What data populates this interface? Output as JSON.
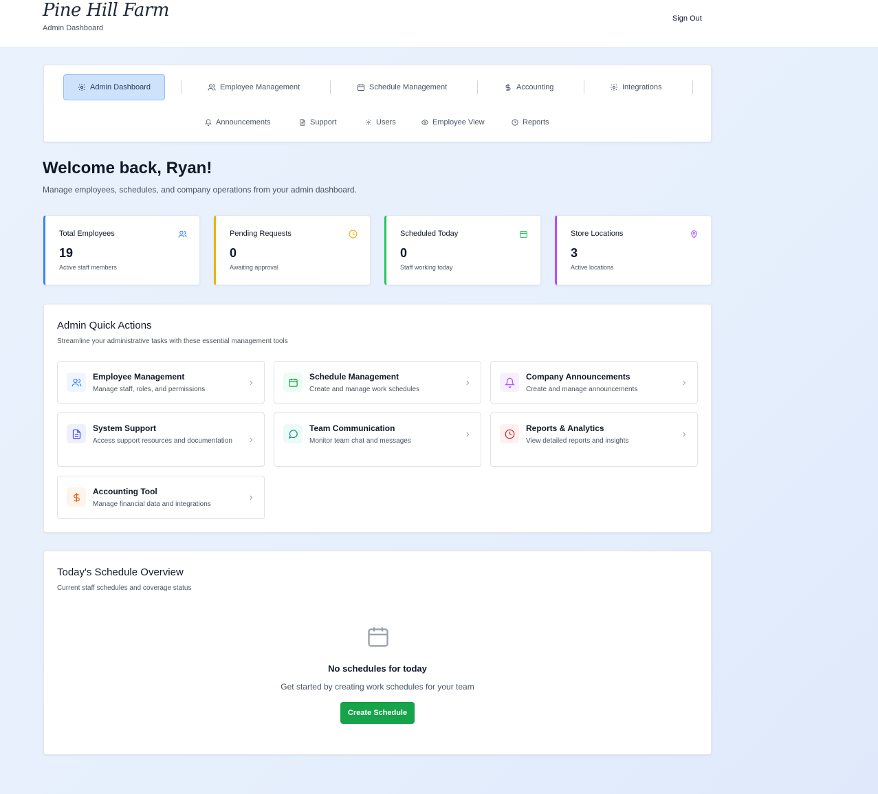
{
  "header": {
    "logo_text": "Pine Hill Farm",
    "subtitle": "Admin Dashboard",
    "sign_out": "Sign Out"
  },
  "nav": {
    "row1": [
      {
        "label": "Admin Dashboard",
        "icon": "gear-icon",
        "active": true
      },
      {
        "label": "Employee Management",
        "icon": "users-icon"
      },
      {
        "label": "Schedule Management",
        "icon": "calendar-icon"
      },
      {
        "label": "Accounting",
        "icon": "dollar-icon"
      },
      {
        "label": "Integrations",
        "icon": "gear-icon"
      }
    ],
    "row2": [
      {
        "label": "Announcements",
        "icon": "bell-icon"
      },
      {
        "label": "Support",
        "icon": "document-icon"
      },
      {
        "label": "Users",
        "icon": "gear-icon"
      },
      {
        "label": "Employee View",
        "icon": "eye-icon"
      },
      {
        "label": "Reports",
        "icon": "clock-icon"
      }
    ]
  },
  "welcome": {
    "title": "Welcome back, Ryan!",
    "subtitle": "Manage employees, schedules, and company operations from your admin dashboard."
  },
  "stats": [
    {
      "label": "Total Employees",
      "value": "19",
      "desc": "Active staff members",
      "icon": "users-icon",
      "color": "#3b82f6"
    },
    {
      "label": "Pending Requests",
      "value": "0",
      "desc": "Awaiting approval",
      "icon": "clock-icon",
      "color": "#eab308"
    },
    {
      "label": "Scheduled Today",
      "value": "0",
      "desc": "Staff working today",
      "icon": "calendar-icon",
      "color": "#22c55e"
    },
    {
      "label": "Store Locations",
      "value": "3",
      "desc": "Active locations",
      "icon": "map-pin-icon",
      "color": "#a855f7"
    }
  ],
  "quick_actions": {
    "title": "Admin Quick Actions",
    "subtitle": "Streamline your administrative tasks with these essential management tools",
    "items": [
      {
        "title": "Employee Management",
        "desc": "Manage staff, roles, and permissions",
        "icon": "users-icon",
        "color": "#3b82f6",
        "bg": "#eff6ff"
      },
      {
        "title": "Schedule Management",
        "desc": "Create and manage work schedules",
        "icon": "calendar-icon",
        "color": "#16a34a",
        "bg": "#ecfdf3"
      },
      {
        "title": "Company Announcements",
        "desc": "Create and manage announcements",
        "icon": "bell-icon",
        "color": "#a855f7",
        "bg": "#f7f0fe"
      },
      {
        "title": "System Support",
        "desc": "Access support resources and documentation",
        "icon": "document-icon",
        "color": "#4f46e5",
        "bg": "#eef0fd"
      },
      {
        "title": "Team Communication",
        "desc": "Monitor team chat and messages",
        "icon": "chat-icon",
        "color": "#0d9488",
        "bg": "#ecfbf8"
      },
      {
        "title": "Reports & Analytics",
        "desc": "View detailed reports and insights",
        "icon": "clock-icon",
        "color": "#dc2626",
        "bg": "#fef1f1"
      },
      {
        "title": "Accounting Tool",
        "desc": "Manage financial data and integrations",
        "icon": "dollar-icon",
        "color": "#ea580c",
        "bg": "#fff4ec"
      }
    ]
  },
  "schedule_overview": {
    "title": "Today's Schedule Overview",
    "subtitle": "Current staff schedules and coverage status",
    "empty_title": "No schedules for today",
    "empty_sub": "Get started by creating work schedules for your team",
    "button": "Create Schedule",
    "empty_icon": "calendar-icon"
  }
}
